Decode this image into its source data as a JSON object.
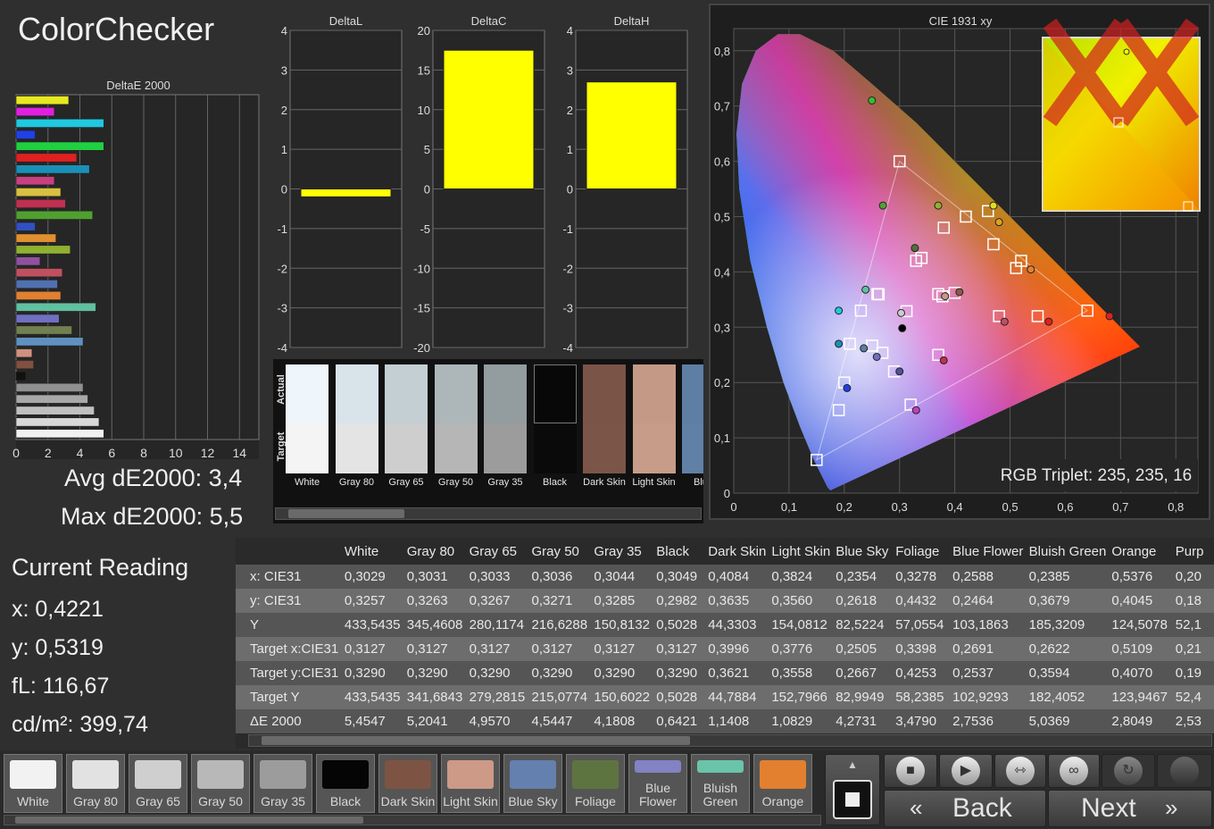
{
  "title": "ColorChecker",
  "deltaE_chart": {
    "title": "DeltaE 2000",
    "ticks": [
      "0",
      "2",
      "4",
      "6",
      "8",
      "10",
      "12",
      "14"
    ],
    "xmax": 14
  },
  "deltaE_bars": [
    {
      "value": 3.3,
      "color": "#e8e820"
    },
    {
      "value": 2.4,
      "color": "#e020e0"
    },
    {
      "value": 5.5,
      "color": "#20c8e0"
    },
    {
      "value": 1.2,
      "color": "#2040e8"
    },
    {
      "value": 5.5,
      "color": "#20d040"
    },
    {
      "value": 3.8,
      "color": "#e02020"
    },
    {
      "value": 4.6,
      "color": "#1a90b8"
    },
    {
      "value": 2.4,
      "color": "#c84080"
    },
    {
      "value": 2.8,
      "color": "#d8c040"
    },
    {
      "value": 3.1,
      "color": "#c03050"
    },
    {
      "value": 4.8,
      "color": "#50a030"
    },
    {
      "value": 1.2,
      "color": "#3050c0"
    },
    {
      "value": 2.5,
      "color": "#e09030"
    },
    {
      "value": 3.4,
      "color": "#90b030"
    },
    {
      "value": 1.5,
      "color": "#9050a0"
    },
    {
      "value": 2.9,
      "color": "#c05060"
    },
    {
      "value": 2.6,
      "color": "#5070b0"
    },
    {
      "value": 2.8,
      "color": "#e08030"
    },
    {
      "value": 5.0,
      "color": "#60c0a0"
    },
    {
      "value": 2.7,
      "color": "#7070c0"
    },
    {
      "value": 3.5,
      "color": "#708050"
    },
    {
      "value": 4.2,
      "color": "#6090c0"
    },
    {
      "value": 1.0,
      "color": "#d09080"
    },
    {
      "value": 1.1,
      "color": "#805040"
    },
    {
      "value": 0.6,
      "color": "#111111"
    },
    {
      "value": 4.2,
      "color": "#909090"
    },
    {
      "value": 4.5,
      "color": "#a8a8a8"
    },
    {
      "value": 4.9,
      "color": "#c0c0c0"
    },
    {
      "value": 5.2,
      "color": "#d8d8d8"
    },
    {
      "value": 5.5,
      "color": "#f0f0f0"
    }
  ],
  "avg_label": "Avg dE2000: 3,4",
  "max_label": "Max dE2000: 5,5",
  "deltaL": {
    "title": "DeltaL",
    "ticks": [
      "4",
      "3",
      "2",
      "1",
      "0",
      "-1",
      "-2",
      "-3",
      "-4"
    ],
    "value": -0.2,
    "min": -4,
    "max": 4
  },
  "deltaC": {
    "title": "DeltaC",
    "ticks": [
      "20",
      "15",
      "10",
      "5",
      "0",
      "-5",
      "-10",
      "-15",
      "-20"
    ],
    "value": 17.5,
    "min": -20,
    "max": 20
  },
  "deltaH": {
    "title": "DeltaH",
    "ticks": [
      "4",
      "3",
      "2",
      "1",
      "0",
      "-1",
      "-2",
      "-3",
      "-4"
    ],
    "value": 2.7,
    "min": -4,
    "max": 4
  },
  "patch_strip": {
    "actual_label": "Actual",
    "target_label": "Target",
    "patches": [
      {
        "name": "White",
        "actual": "#eef6fc",
        "target": "#f4f4f4"
      },
      {
        "name": "Gray 80",
        "actual": "#d9e4ea",
        "target": "#e4e4e4"
      },
      {
        "name": "Gray 65",
        "actual": "#c3cfd2",
        "target": "#cecece"
      },
      {
        "name": "Gray 50",
        "actual": "#adb7ba",
        "target": "#b6b6b6"
      },
      {
        "name": "Gray 35",
        "actual": "#939c9e",
        "target": "#9c9c9c"
      },
      {
        "name": "Black",
        "actual": "#080808",
        "target": "#0a0a0a"
      },
      {
        "name": "Dark Skin",
        "actual": "#7a5446",
        "target": "#7b5548"
      },
      {
        "name": "Light Skin",
        "actual": "#c49a86",
        "target": "#c79c88"
      },
      {
        "name": "Blue",
        "actual": "#5e7ea4",
        "target": "#6080a6"
      }
    ]
  },
  "cie": {
    "title": "CIE 1931 xy",
    "x_ticks": [
      "0",
      "0,1",
      "0,2",
      "0,3",
      "0,4",
      "0,5",
      "0,6",
      "0,7",
      "0,8"
    ],
    "y_ticks": [
      "0,8",
      "0,7",
      "0,6",
      "0,5",
      "0,4",
      "0,3",
      "0,2",
      "0,1",
      "0"
    ],
    "rgb_triplet": "RGB Triplet: 235, 235, 16",
    "targets": [
      [
        0.3127,
        0.329
      ],
      [
        0.64,
        0.33
      ],
      [
        0.3,
        0.6
      ],
      [
        0.15,
        0.06
      ],
      [
        0.3398,
        0.4253
      ],
      [
        0.2505,
        0.2667
      ],
      [
        0.2691,
        0.2537
      ],
      [
        0.2622,
        0.3594
      ],
      [
        0.5109,
        0.407
      ],
      [
        0.3776,
        0.3558
      ],
      [
        0.3996,
        0.3621
      ],
      [
        0.46,
        0.51
      ],
      [
        0.42,
        0.5
      ],
      [
        0.38,
        0.48
      ],
      [
        0.33,
        0.42
      ],
      [
        0.26,
        0.36
      ],
      [
        0.23,
        0.33
      ],
      [
        0.21,
        0.27
      ],
      [
        0.19,
        0.15
      ],
      [
        0.2,
        0.2
      ],
      [
        0.29,
        0.22
      ],
      [
        0.32,
        0.16
      ],
      [
        0.37,
        0.25
      ],
      [
        0.48,
        0.32
      ],
      [
        0.55,
        0.32
      ],
      [
        0.52,
        0.42
      ],
      [
        0.47,
        0.45
      ],
      [
        0.37,
        0.36
      ]
    ],
    "measured": [
      [
        0.3029,
        0.3257,
        "#cccccc"
      ],
      [
        0.3049,
        0.2982,
        "#000000"
      ],
      [
        0.4084,
        0.3635,
        "#8a5a48"
      ],
      [
        0.3824,
        0.356,
        "#c59a88"
      ],
      [
        0.2354,
        0.2618,
        "#5a7ea8"
      ],
      [
        0.3278,
        0.4432,
        "#50703a"
      ],
      [
        0.2588,
        0.2464,
        "#7070c0"
      ],
      [
        0.2385,
        0.3679,
        "#60c0a0"
      ],
      [
        0.5376,
        0.4045,
        "#e08030"
      ],
      [
        0.47,
        0.52,
        "#e0e020"
      ],
      [
        0.48,
        0.49,
        "#e0a020"
      ],
      [
        0.25,
        0.71,
        "#30c030"
      ],
      [
        0.27,
        0.52,
        "#50a030"
      ],
      [
        0.37,
        0.52,
        "#90b030"
      ],
      [
        0.19,
        0.33,
        "#20c8e0"
      ],
      [
        0.19,
        0.27,
        "#1a90b8"
      ],
      [
        0.205,
        0.19,
        "#2040e8"
      ],
      [
        0.3,
        0.22,
        "#5050a0"
      ],
      [
        0.33,
        0.15,
        "#c040c0"
      ],
      [
        0.38,
        0.24,
        "#c03050"
      ],
      [
        0.49,
        0.31,
        "#c05060"
      ],
      [
        0.57,
        0.31,
        "#e02020"
      ],
      [
        0.68,
        0.32,
        "#e02020"
      ]
    ]
  },
  "current_reading": {
    "title": "Current Reading",
    "x": "x: 0,4221",
    "y": "y: 0,5319",
    "fl": "fL: 116,67",
    "cd": "cd/m²: 399,74"
  },
  "table": {
    "headers": [
      "White",
      "Gray 80",
      "Gray 65",
      "Gray 50",
      "Gray 35",
      "Black",
      "Dark Skin",
      "Light Skin",
      "Blue Sky",
      "Foliage",
      "Blue Flower",
      "Bluish Green",
      "Orange",
      "Purp"
    ],
    "rows": [
      {
        "label": "x: CIE31",
        "values": [
          "0,3029",
          "0,3031",
          "0,3033",
          "0,3036",
          "0,3044",
          "0,3049",
          "0,4084",
          "0,3824",
          "0,2354",
          "0,3278",
          "0,2588",
          "0,2385",
          "0,5376",
          "0,20"
        ]
      },
      {
        "label": "y: CIE31",
        "values": [
          "0,3257",
          "0,3263",
          "0,3267",
          "0,3271",
          "0,3285",
          "0,2982",
          "0,3635",
          "0,3560",
          "0,2618",
          "0,4432",
          "0,2464",
          "0,3679",
          "0,4045",
          "0,18"
        ]
      },
      {
        "label": "Y",
        "values": [
          "433,5435",
          "345,4608",
          "280,1174",
          "216,6288",
          "150,8132",
          "0,5028",
          "44,3303",
          "154,0812",
          "82,5224",
          "57,0554",
          "103,1863",
          "185,3209",
          "124,5078",
          "52,1"
        ]
      },
      {
        "label": "Target x:CIE31",
        "values": [
          "0,3127",
          "0,3127",
          "0,3127",
          "0,3127",
          "0,3127",
          "0,3127",
          "0,3996",
          "0,3776",
          "0,2505",
          "0,3398",
          "0,2691",
          "0,2622",
          "0,5109",
          "0,21"
        ]
      },
      {
        "label": "Target y:CIE31",
        "values": [
          "0,3290",
          "0,3290",
          "0,3290",
          "0,3290",
          "0,3290",
          "0,3290",
          "0,3621",
          "0,3558",
          "0,2667",
          "0,4253",
          "0,2537",
          "0,3594",
          "0,4070",
          "0,19"
        ]
      },
      {
        "label": "Target Y",
        "values": [
          "433,5435",
          "341,6843",
          "279,2815",
          "215,0774",
          "150,6022",
          "0,5028",
          "44,7884",
          "152,7966",
          "82,9949",
          "58,2385",
          "102,9293",
          "182,4052",
          "123,9467",
          "52,4"
        ]
      },
      {
        "label": "ΔE 2000",
        "values": [
          "5,4547",
          "5,2041",
          "4,9570",
          "4,5447",
          "4,1808",
          "0,6421",
          "1,1408",
          "1,0829",
          "4,2731",
          "3,4790",
          "2,7536",
          "5,0369",
          "2,8049",
          "2,53"
        ]
      }
    ]
  },
  "swatches": [
    {
      "label": "White",
      "color": "#f2f2f2"
    },
    {
      "label": "Gray 80",
      "color": "#e2e2e2"
    },
    {
      "label": "Gray 65",
      "color": "#cfcfcf"
    },
    {
      "label": "Gray 50",
      "color": "#b8b8b8"
    },
    {
      "label": "Gray 35",
      "color": "#9c9c9c"
    },
    {
      "label": "Black",
      "color": "#050505"
    },
    {
      "label": "Dark Skin",
      "color": "#7d5444"
    },
    {
      "label": "Light Skin",
      "color": "#cc9a86"
    },
    {
      "label": "Blue Sky",
      "color": "#6480ae"
    },
    {
      "label": "Foliage",
      "color": "#5e7440"
    },
    {
      "label": "Blue\nFlower",
      "color": "#8282c4"
    },
    {
      "label": "Bluish\nGreen",
      "color": "#6ac4aa"
    },
    {
      "label": "Orange",
      "color": "#e28030"
    }
  ],
  "nav": {
    "back": "Back",
    "next": "Next"
  }
}
